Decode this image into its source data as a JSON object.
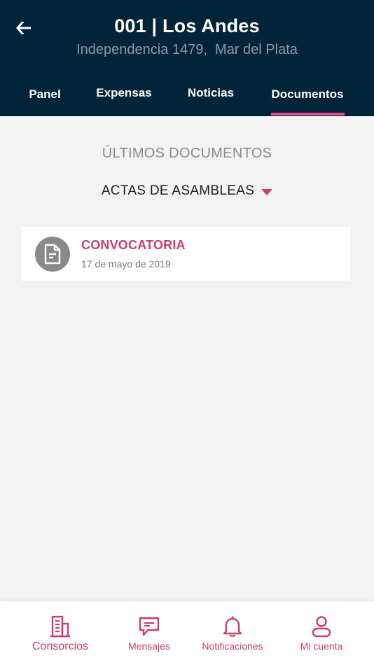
{
  "header": {
    "title": "001 | Los Andes",
    "subtitle": "Independencia 1479,  Mar del Plata"
  },
  "tabs": [
    {
      "label": "Panel"
    },
    {
      "label": "Expensas"
    },
    {
      "label": "Noticias"
    },
    {
      "label": "Documentos",
      "active": true
    }
  ],
  "content": {
    "section_title": "ÚLTIMOS DOCUMENTOS",
    "category": "ACTAS DE ASAMBLEAS",
    "documents": [
      {
        "title": "CONVOCATORIA",
        "date": "17 de mayo de 2019",
        "icon": "document-icon"
      }
    ]
  },
  "bottom_nav": [
    {
      "label": "Consorcios",
      "icon": "building-icon",
      "active": true
    },
    {
      "label": "Mensajes",
      "icon": "message-icon"
    },
    {
      "label": "Notificaciones",
      "icon": "bell-icon"
    },
    {
      "label": "Mi cuenta",
      "icon": "user-icon"
    }
  ],
  "colors": {
    "header_bg": "#022438",
    "accent": "#c93d6f",
    "tab_indicator": "#e04f86",
    "background": "#f3f3f3"
  }
}
